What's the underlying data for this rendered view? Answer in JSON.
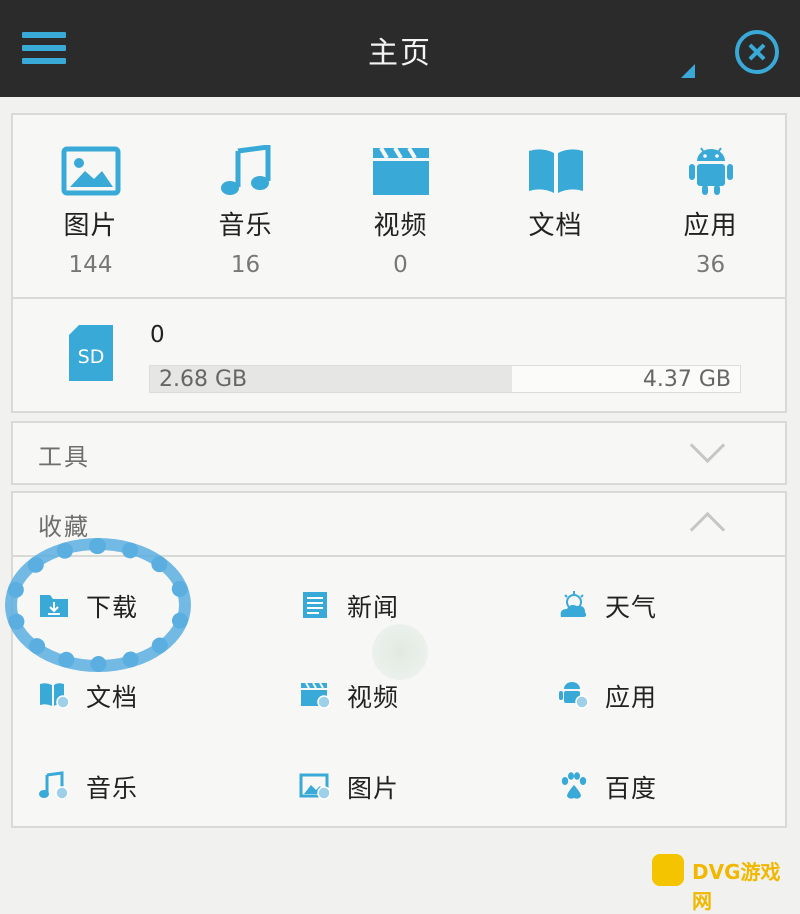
{
  "header": {
    "title": "主页",
    "accent_color": "#39a9d7"
  },
  "categories": [
    {
      "label": "图片",
      "count": "144",
      "icon": "image-icon"
    },
    {
      "label": "音乐",
      "count": "16",
      "icon": "music-note-icon"
    },
    {
      "label": "视频",
      "count": "0",
      "icon": "clapperboard-icon"
    },
    {
      "label": "文档",
      "count": "",
      "icon": "book-icon"
    },
    {
      "label": "应用",
      "count": "36",
      "icon": "android-icon"
    }
  ],
  "storage": {
    "icon_label": "SD",
    "name": "0",
    "used": "2.68 GB",
    "total": "4.37 GB",
    "used_fraction": 0.613
  },
  "tools": {
    "title": "工具"
  },
  "favorites": {
    "title": "收藏",
    "items": [
      {
        "label": "下载",
        "icon": "download-folder-icon"
      },
      {
        "label": "新闻",
        "icon": "news-icon"
      },
      {
        "label": "天气",
        "icon": "weather-icon"
      },
      {
        "label": "文档",
        "icon": "book-icon"
      },
      {
        "label": "视频",
        "icon": "clapperboard-icon"
      },
      {
        "label": "应用",
        "icon": "android-icon"
      },
      {
        "label": "音乐",
        "icon": "music-note-icon"
      },
      {
        "label": "图片",
        "icon": "image-icon"
      },
      {
        "label": "百度",
        "icon": "paw-icon"
      }
    ]
  },
  "watermark": {
    "text": "DVG游戏网"
  }
}
